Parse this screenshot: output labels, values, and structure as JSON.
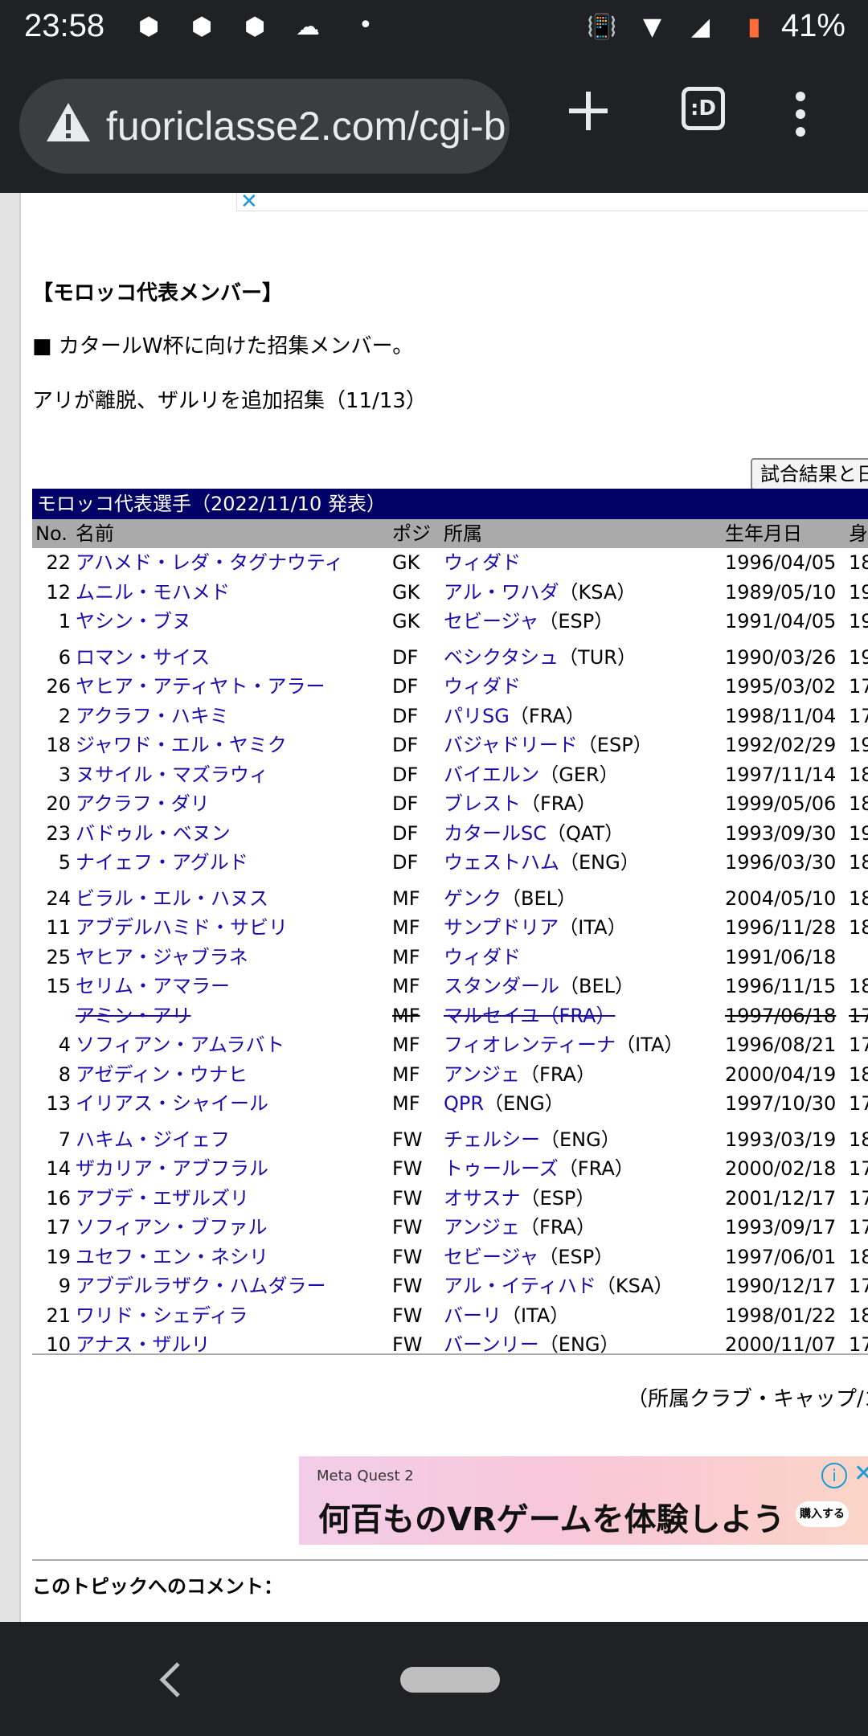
{
  "status_bar": {
    "time": "23:58",
    "battery": "41%"
  },
  "toolbar": {
    "url": "fuoriclasse2.com/cgi-b",
    "tab_label": ":D"
  },
  "content": {
    "heading": "【モロッコ代表メンバー】",
    "note1": "■ カタールW杯に向けた招集メンバー。",
    "note2": "アリが離脱、ザルリを追加招集（11/13）",
    "result_button": "試合結果と日",
    "table_title": "モロッコ代表選手（2022/11/10 発表）",
    "columns": {
      "no": "No.",
      "name": "名前",
      "pos": "ポジ",
      "club": "所属",
      "dob": "生年月日",
      "height": "身"
    },
    "players": [
      {
        "no": "22",
        "name": "アハメド・レダ・タグナウティ",
        "pos": "GK",
        "club": "ウィダド",
        "country": "",
        "dob": "1996/04/05",
        "height": "18"
      },
      {
        "no": "12",
        "name": "ムニル・モハメド",
        "pos": "GK",
        "club": "アル・ワハダ",
        "country": "（KSA）",
        "dob": "1989/05/10",
        "height": "19"
      },
      {
        "no": "1",
        "name": "ヤシン・ブヌ",
        "pos": "GK",
        "club": "セビージャ",
        "country": "（ESP）",
        "dob": "1991/04/05",
        "height": "19"
      },
      {
        "no": "6",
        "name": "ロマン・サイス",
        "pos": "DF",
        "club": "ベシクタシュ",
        "country": "（TUR）",
        "dob": "1990/03/26",
        "height": "19"
      },
      {
        "no": "26",
        "name": "ヤヒア・アティヤト・アラー",
        "pos": "DF",
        "club": "ウィダド",
        "country": "",
        "dob": "1995/03/02",
        "height": "17"
      },
      {
        "no": "2",
        "name": "アクラフ・ハキミ",
        "pos": "DF",
        "club": "パリSG",
        "country": "（FRA）",
        "dob": "1998/11/04",
        "height": "17"
      },
      {
        "no": "18",
        "name": "ジャワド・エル・ヤミク",
        "pos": "DF",
        "club": "バジャドリード",
        "country": "（ESP）",
        "dob": "1992/02/29",
        "height": "19"
      },
      {
        "no": "3",
        "name": "ヌサイル・マズラウィ",
        "pos": "DF",
        "club": "バイエルン",
        "country": "（GER）",
        "dob": "1997/11/14",
        "height": "18"
      },
      {
        "no": "20",
        "name": "アクラフ・ダリ",
        "pos": "DF",
        "club": "ブレスト",
        "country": "（FRA）",
        "dob": "1999/05/06",
        "height": "18"
      },
      {
        "no": "23",
        "name": "バドゥル・ベヌン",
        "pos": "DF",
        "club": "カタールSC",
        "country": "（QAT）",
        "dob": "1993/09/30",
        "height": "19"
      },
      {
        "no": "5",
        "name": "ナイェフ・アグルド",
        "pos": "DF",
        "club": "ウェストハム",
        "country": "（ENG）",
        "dob": "1996/03/30",
        "height": "18"
      },
      {
        "no": "24",
        "name": "ビラル・エル・ハヌス",
        "pos": "MF",
        "club": "ゲンク",
        "country": "（BEL）",
        "dob": "2004/05/10",
        "height": "18"
      },
      {
        "no": "11",
        "name": "アブデルハミド・サビリ",
        "pos": "MF",
        "club": "サンプドリア",
        "country": "（ITA）",
        "dob": "1996/11/28",
        "height": "18"
      },
      {
        "no": "25",
        "name": "ヤヒア・ジャブラネ",
        "pos": "MF",
        "club": "ウィダド",
        "country": "",
        "dob": "1991/06/18",
        "height": ""
      },
      {
        "no": "15",
        "name": "セリム・アマラー",
        "pos": "MF",
        "club": "スタンダール",
        "country": "（BEL）",
        "dob": "1996/11/15",
        "height": "18"
      },
      {
        "no": "",
        "name": "アミン・アリ",
        "pos": "MF",
        "club": "マルセイユ",
        "country": "（FRA）",
        "dob": "1997/06/18",
        "height": "17",
        "struck": true
      },
      {
        "no": "4",
        "name": "ソフィアン・アムラバト",
        "pos": "MF",
        "club": "フィオレンティーナ",
        "country": "（ITA）",
        "dob": "1996/08/21",
        "height": "17"
      },
      {
        "no": "8",
        "name": "アゼディン・ウナヒ",
        "pos": "MF",
        "club": "アンジェ",
        "country": "（FRA）",
        "dob": "2000/04/19",
        "height": "18"
      },
      {
        "no": "13",
        "name": "イリアス・シャイール",
        "pos": "MF",
        "club": "QPR",
        "country": "（ENG）",
        "dob": "1997/10/30",
        "height": "17"
      },
      {
        "no": "7",
        "name": "ハキム・ジイェフ",
        "pos": "FW",
        "club": "チェルシー",
        "country": "（ENG）",
        "dob": "1993/03/19",
        "height": "18"
      },
      {
        "no": "14",
        "name": "ザカリア・アブフラル",
        "pos": "FW",
        "club": "トゥールーズ",
        "country": "（FRA）",
        "dob": "2000/02/18",
        "height": "17"
      },
      {
        "no": "16",
        "name": "アブデ・エザルズリ",
        "pos": "FW",
        "club": "オサスナ",
        "country": "（ESP）",
        "dob": "2001/12/17",
        "height": "17"
      },
      {
        "no": "17",
        "name": "ソフィアン・ブファル",
        "pos": "FW",
        "club": "アンジェ",
        "country": "（FRA）",
        "dob": "1993/09/17",
        "height": "17"
      },
      {
        "no": "19",
        "name": "ユセフ・エン・ネシリ",
        "pos": "FW",
        "club": "セビージャ",
        "country": "（ESP）",
        "dob": "1997/06/01",
        "height": "18"
      },
      {
        "no": "9",
        "name": "アブデルラザク・ハムダラー",
        "pos": "FW",
        "club": "アル・イティハド",
        "country": "（KSA）",
        "dob": "1990/12/17",
        "height": "17"
      },
      {
        "no": "21",
        "name": "ワリド・シェディラ",
        "pos": "FW",
        "club": "バーリ",
        "country": "（ITA）",
        "dob": "1998/01/22",
        "height": "18"
      },
      {
        "no": "10",
        "name": "アナス・ザルリ",
        "pos": "FW",
        "club": "バーンリー",
        "country": "（ENG）",
        "dob": "2000/11/07",
        "height": "17"
      }
    ],
    "caption": "（所属クラブ・キャップ/ゴ",
    "comment_label": "このトピックへのコメント："
  },
  "ad": {
    "brand": "Meta Quest 2",
    "headline": "何百ものVRゲームを体験しよう",
    "cta": "購入する"
  }
}
